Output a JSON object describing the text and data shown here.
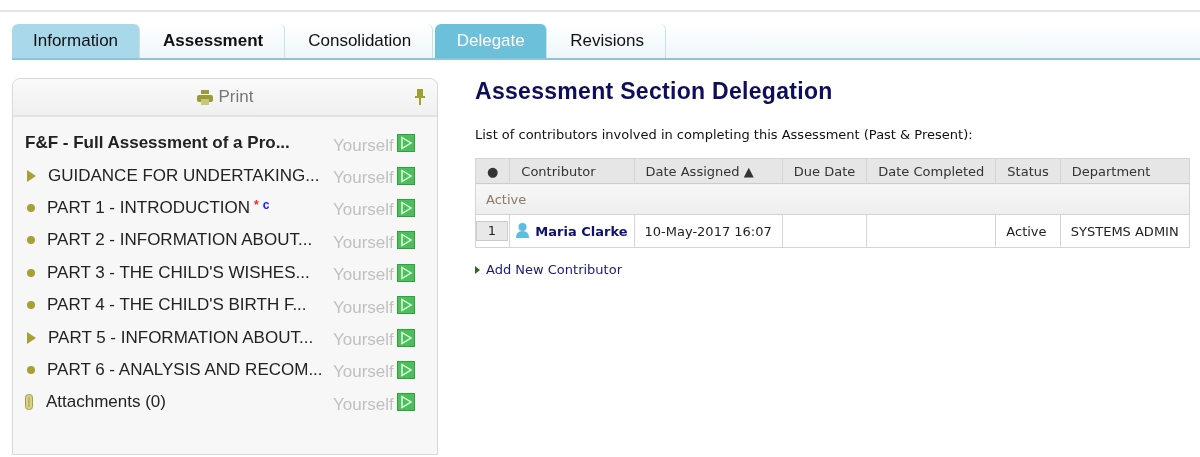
{
  "tabs": [
    {
      "label": "Information",
      "kind": "visited",
      "selected": false
    },
    {
      "label": "Assessment",
      "kind": "current",
      "selected": false
    },
    {
      "label": "Consolidation",
      "kind": "plain",
      "selected": false
    },
    {
      "label": "Delegate",
      "kind": "plain",
      "selected": true
    },
    {
      "label": "Revisions",
      "kind": "plain",
      "selected": false
    }
  ],
  "sidebar": {
    "print_label": "Print",
    "items": [
      {
        "kind": "title",
        "label": "F&F - Full Assessment of a Pro...",
        "assignee": "Yourself"
      },
      {
        "kind": "branch",
        "label": "GUIDANCE FOR UNDERTAKING...",
        "assignee": "Yourself"
      },
      {
        "kind": "leaf",
        "label": "PART 1 - INTRODUCTION",
        "marks": [
          {
            "text": "*",
            "color": "#ff2020"
          },
          {
            "text": "c",
            "color": "#2020ff"
          }
        ],
        "assignee": "Yourself"
      },
      {
        "kind": "leaf",
        "label": "PART 2 - INFORMATION ABOUT...",
        "assignee": "Yourself"
      },
      {
        "kind": "leaf",
        "label": "PART 3 - THE CHILD'S WISHES...",
        "assignee": "Yourself"
      },
      {
        "kind": "leaf",
        "label": "PART 4 - THE CHILD'S BIRTH F...",
        "assignee": "Yourself"
      },
      {
        "kind": "branch",
        "label": "PART 5 - INFORMATION ABOUT...",
        "assignee": "Yourself"
      },
      {
        "kind": "leaf",
        "label": "PART 6 - ANALYSIS AND RECOM...",
        "assignee": "Yourself"
      },
      {
        "kind": "attachments",
        "label": "Attachments (0)",
        "assignee": "Yourself"
      }
    ]
  },
  "main": {
    "title": "Assessment Section Delegation",
    "intro": "List of contributors involved in completing this Assessment (Past & Present):",
    "table": {
      "columns": [
        "●",
        "Contributor",
        "Date Assigned ▲",
        "Due Date",
        "Date Completed",
        "Status",
        "Department"
      ],
      "groups": [
        {
          "label": "Active",
          "rows": [
            {
              "index": "1",
              "contributor": "Maria Clarke",
              "date_assigned": "10-May-2017 16:07",
              "status": "Active",
              "department": "SYSTEMS ADMIN"
            }
          ]
        }
      ]
    },
    "add_link": "Add New Contributor"
  }
}
